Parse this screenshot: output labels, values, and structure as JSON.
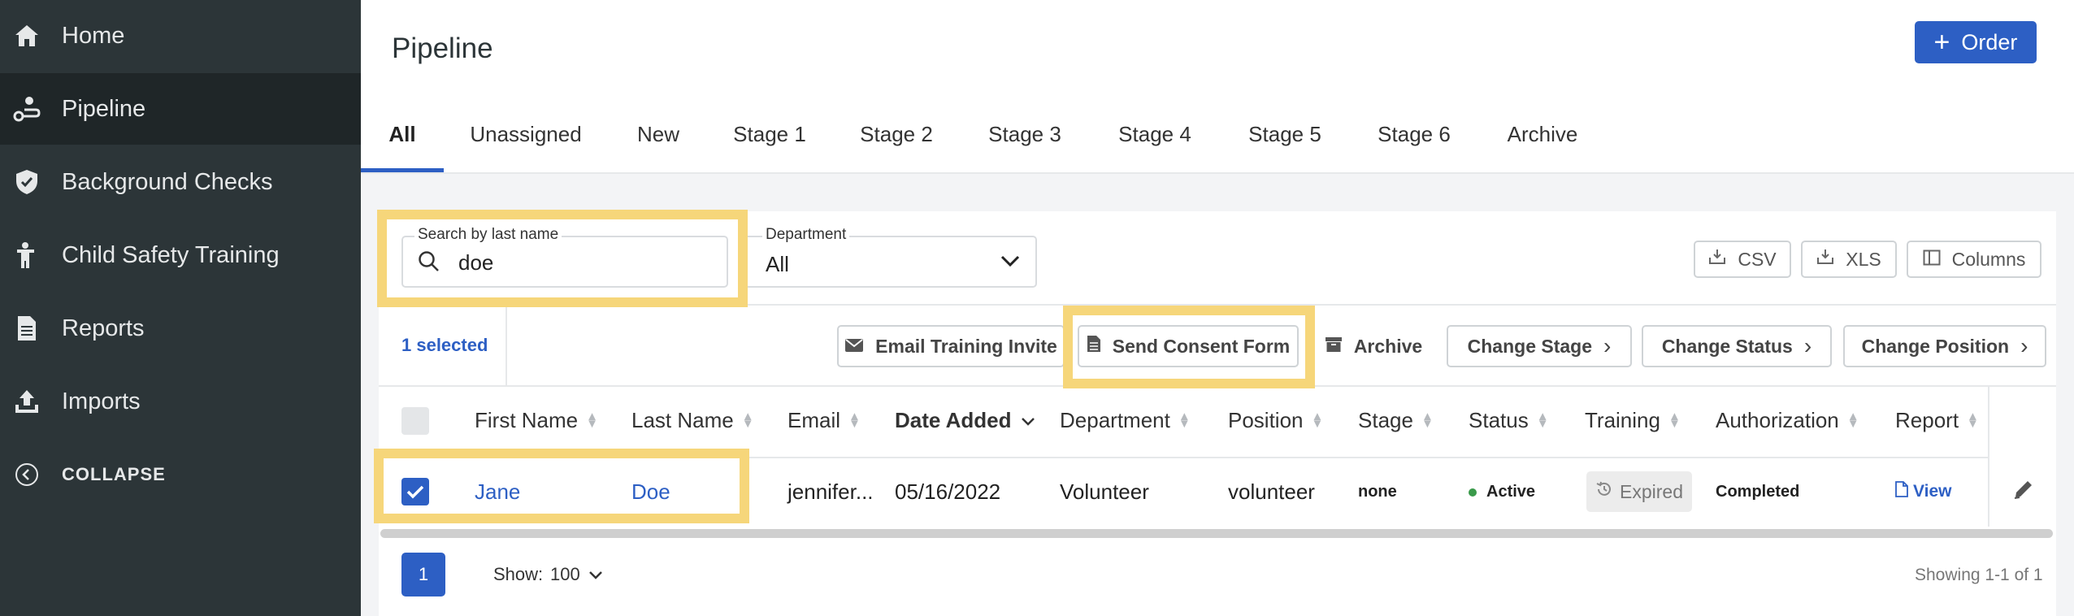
{
  "sidebar": {
    "items": [
      {
        "label": "Home",
        "icon": "home-icon"
      },
      {
        "label": "Pipeline",
        "icon": "pipeline-icon",
        "active": true
      },
      {
        "label": "Background Checks",
        "icon": "shield-check-icon"
      },
      {
        "label": "Child Safety Training",
        "icon": "person-training-icon"
      },
      {
        "label": "Reports",
        "icon": "document-icon"
      },
      {
        "label": "Imports",
        "icon": "upload-icon"
      }
    ],
    "collapse_label": "COLLAPSE"
  },
  "header": {
    "title": "Pipeline",
    "order_label": "Order",
    "tabs": [
      "All",
      "Unassigned",
      "New",
      "Stage 1",
      "Stage 2",
      "Stage 3",
      "Stage 4",
      "Stage 5",
      "Stage 6",
      "Archive"
    ]
  },
  "filters": {
    "search_label": "Search by last name",
    "search_value": "doe",
    "department_label": "Department",
    "department_value": "All"
  },
  "export": {
    "csv": "CSV",
    "xls": "XLS",
    "columns": "Columns"
  },
  "actions": {
    "selected": "1 selected",
    "email_invite": "Email Training Invite",
    "send_consent": "Send Consent Form",
    "archive": "Archive",
    "change_stage": "Change Stage",
    "change_status": "Change Status",
    "change_position": "Change Position"
  },
  "table": {
    "columns": [
      "First Name",
      "Last Name",
      "Email",
      "Date Added",
      "Department",
      "Position",
      "Stage",
      "Status",
      "Training",
      "Authorization",
      "Report"
    ],
    "row": {
      "first_name": "Jane",
      "last_name": "Doe",
      "email": "jennifer...",
      "date_added": "05/16/2022",
      "department": "Volunteer",
      "position": "volunteer",
      "stage": "none",
      "status": "Active",
      "training": "Expired",
      "authorization": "Completed",
      "report": "View"
    }
  },
  "pagination": {
    "page": "1",
    "show_label": "Show:",
    "show_value": "100",
    "showing": "Showing 1-1 of 1"
  },
  "colors": {
    "accent": "#2d5fc4",
    "sidebar": "#2c3538",
    "highlight": "#f6d67a",
    "status_active": "#3a9a4a"
  }
}
